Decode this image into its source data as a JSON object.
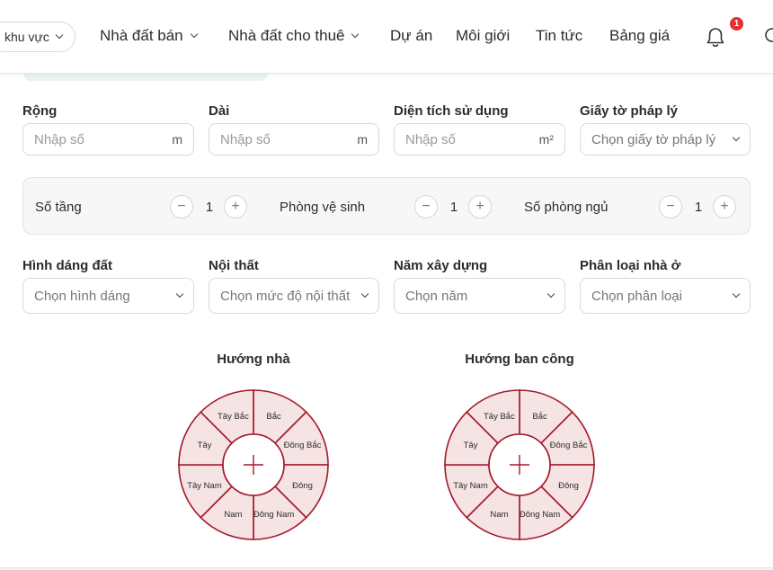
{
  "header": {
    "area_selector": "khu vực",
    "nav": [
      {
        "label": "Nhà đất bán",
        "dropdown": true
      },
      {
        "label": "Nhà đất cho thuê",
        "dropdown": true
      },
      {
        "label": "Dự án",
        "dropdown": false
      },
      {
        "label": "Môi giới",
        "dropdown": false
      },
      {
        "label": "Tin tức",
        "dropdown": false
      },
      {
        "label": "Bảng giá",
        "dropdown": false
      }
    ],
    "notification_count": "1"
  },
  "form": {
    "width": {
      "label": "Rộng",
      "placeholder": "Nhập số",
      "unit": "m"
    },
    "length": {
      "label": "Dài",
      "placeholder": "Nhập số",
      "unit": "m"
    },
    "usable_area": {
      "label": "Diện tích sử dụng",
      "placeholder": "Nhập số",
      "unit": "m²"
    },
    "legal": {
      "label": "Giấy tờ pháp lý",
      "placeholder": "Chọn giấy tờ pháp lý"
    },
    "floors": {
      "label": "Số tầng",
      "value": "1"
    },
    "bathrooms": {
      "label": "Phòng vệ sinh",
      "value": "1"
    },
    "bedrooms": {
      "label": "Số phòng ngủ",
      "value": "1"
    },
    "land_shape": {
      "label": "Hình dáng đất",
      "placeholder": "Chọn hình dáng"
    },
    "furniture": {
      "label": "Nội thất",
      "placeholder": "Chọn mức độ nội thất"
    },
    "year_built": {
      "label": "Năm xây dựng",
      "placeholder": "Chọn năm"
    },
    "house_type": {
      "label": "Phân loại nhà ở",
      "placeholder": "Chọn phân loại"
    }
  },
  "compass": {
    "house_direction_title": "Hướng nhà",
    "balcony_direction_title": "Hướng ban công",
    "directions": [
      "Bắc",
      "Đông Bắc",
      "Đông",
      "Đông Nam",
      "Nam",
      "Tây Nam",
      "Tây",
      "Tây Bắc"
    ],
    "fill_color": "#f6e3e3",
    "stroke_color": "#a3182b"
  }
}
